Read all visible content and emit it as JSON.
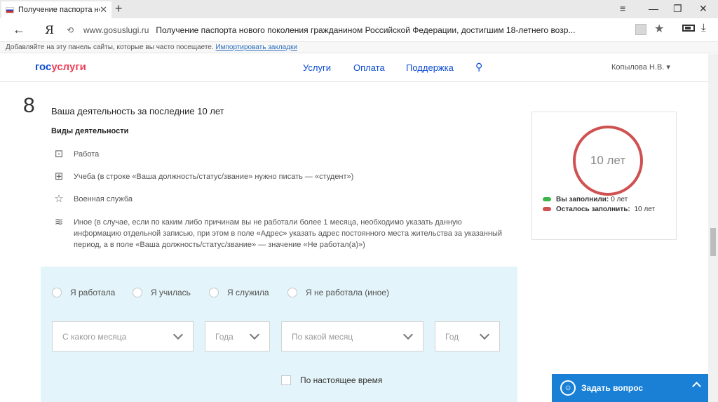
{
  "browser": {
    "tab_title": "Получение паспорта но",
    "url_host": "www.gosuslugi.ru",
    "url_title": "Получение паспорта нового поколения гражданином Российской Федерации, достигшим 18-летнего возр...",
    "bookmarks_text": "Добавляйте на эту панель сайты, которые вы часто посещаете.",
    "bookmarks_link": "Импортировать закладки",
    "yandex_label": "Я"
  },
  "site": {
    "logo_part1": "гос",
    "logo_part2": "услуги",
    "menu": [
      "Услуги",
      "Оплата",
      "Поддержка"
    ],
    "user_name": "Копылова Н.В. ▾"
  },
  "step": {
    "number": "8",
    "title": "Ваша деятельность за последние 10 лет",
    "kinds_label": "Виды деятельности",
    "items": [
      {
        "icon": "briefcase-icon",
        "text": "Работа"
      },
      {
        "icon": "book-icon",
        "text": "Учеба (в строке «Ваша должность/статус/звание» нужно писать — «студент»)"
      },
      {
        "icon": "star-icon",
        "text": "Военная служба"
      },
      {
        "icon": "layers-icon",
        "text": "Иное (в случае, если по каким либо причинам вы не работали более 1 месяца, необходимо указать данную информацию отдельной записью, при этом в поле «Адрес» указать адрес постоянного места жительства за указанный период, а в поле «Ваша должность/статус/звание» — значение «Не работал(а)»)"
      }
    ]
  },
  "progress": {
    "ring_label": "10 лет",
    "filled_label": "Вы заполнили:",
    "filled_value": "0 лет",
    "remaining_label": "Осталось заполнить:",
    "remaining_value": "10 лет",
    "filled_color": "#3cb54a",
    "remaining_color": "#cf5151"
  },
  "form": {
    "radios": [
      "Я работала",
      "Я училась",
      "Я служила",
      "Я не работала (иное)"
    ],
    "from_month_placeholder": "С какого месяца",
    "from_year_placeholder": "Года",
    "to_month_placeholder": "По какой месяц",
    "to_year_placeholder": "Год",
    "present_label": "По настоящее время"
  },
  "ask_button": "Задать вопрос"
}
